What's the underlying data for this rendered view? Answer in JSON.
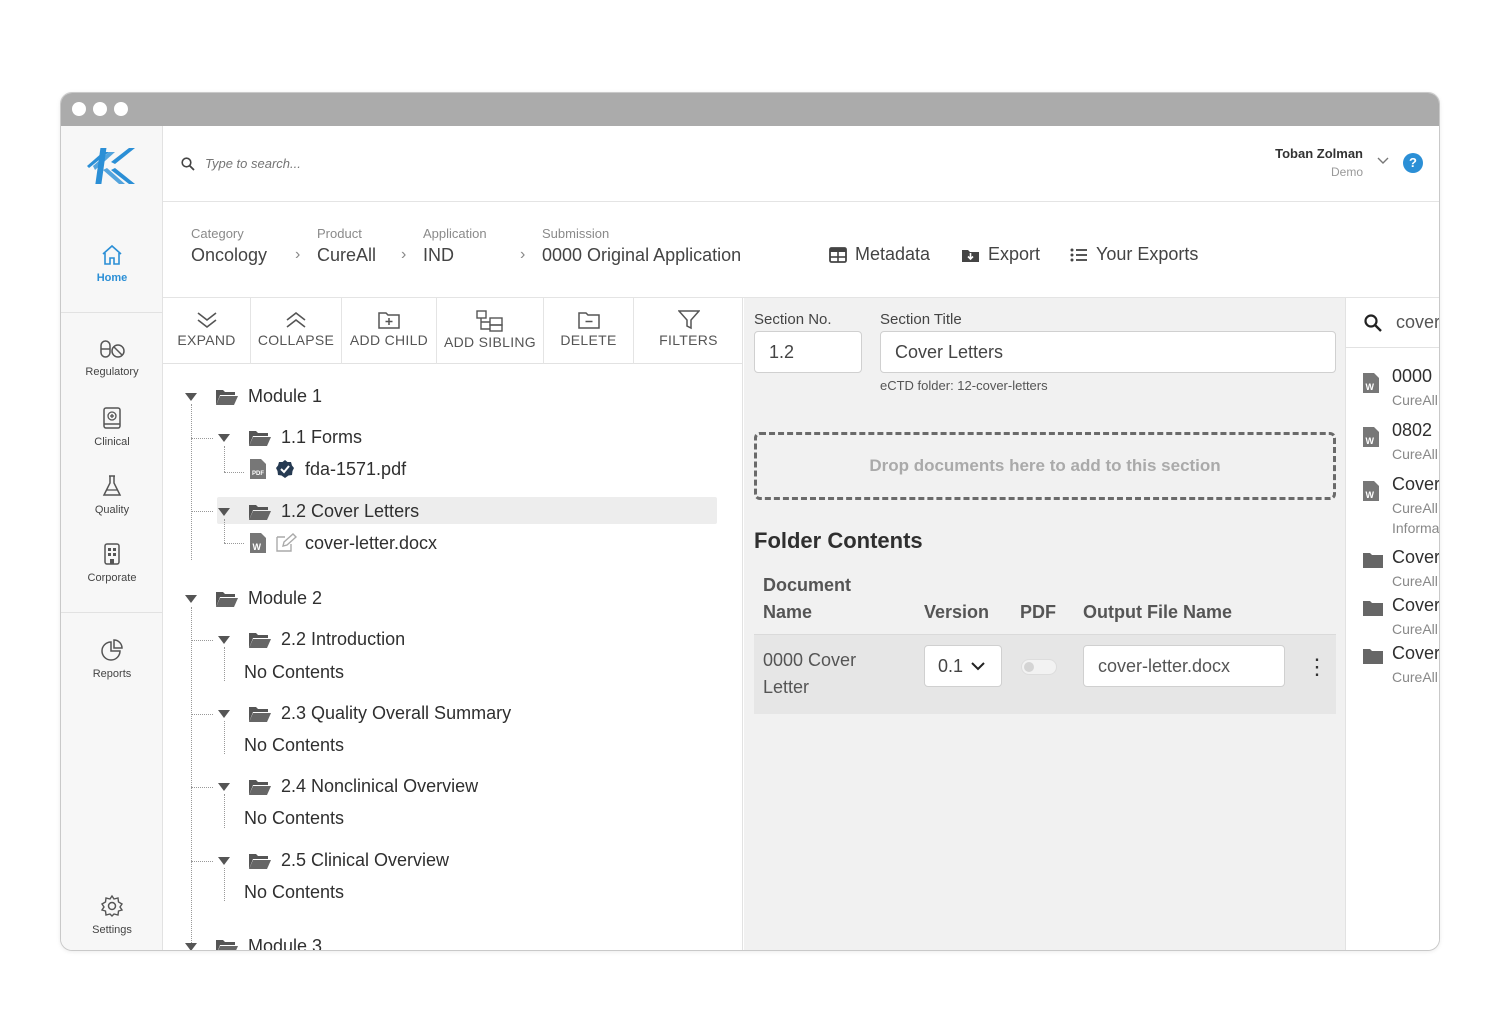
{
  "user": {
    "name": "Toban Zolman",
    "role": "Demo"
  },
  "search": {
    "placeholder": "Type to search..."
  },
  "nav": {
    "home": "Home",
    "regulatory": "Regulatory",
    "clinical": "Clinical",
    "quality": "Quality",
    "corporate": "Corporate",
    "reports": "Reports",
    "settings": "Settings"
  },
  "breadcrumb": [
    {
      "label": "Category",
      "value": "Oncology"
    },
    {
      "label": "Product",
      "value": "CureAll"
    },
    {
      "label": "Application",
      "value": "IND"
    },
    {
      "label": "Submission",
      "value": "0000 Original Application"
    }
  ],
  "actions": {
    "metadata": "Metadata",
    "export": "Export",
    "your_exports": "Your Exports"
  },
  "toolbar": {
    "expand": "EXPAND",
    "collapse": "COLLAPSE",
    "add_child": "ADD CHILD",
    "add_sibling": "ADD SIBLING",
    "delete": "DELETE",
    "filters": "FILTERS"
  },
  "tree": {
    "module1": "Module 1",
    "forms": "1.1 Forms",
    "fda_file": "fda-1571.pdf",
    "cover_letters": "1.2 Cover Letters",
    "cover_file": "cover-letter.docx",
    "module2": "Module 2",
    "intro": "2.2 Introduction",
    "qos": "2.3 Quality Overall Summary",
    "nonclinical": "2.4 Nonclinical Overview",
    "clinical": "2.5 Clinical Overview",
    "no_contents": "No Contents",
    "module3": "Module 3"
  },
  "section": {
    "no_label": "Section No.",
    "no_value": "1.2",
    "title_label": "Section Title",
    "title_value": "Cover Letters",
    "ectd_folder": "eCTD folder: 12-cover-letters",
    "dropzone": "Drop documents here to add to this section",
    "folder_contents": "Folder Contents"
  },
  "table": {
    "headers": {
      "doc_name_1": "Document",
      "doc_name_2": "Name",
      "version": "Version",
      "pdf": "PDF",
      "output": "Output File Name"
    },
    "rows": [
      {
        "name_1": "0000 Cover",
        "name_2": "Letter",
        "version": "0.1",
        "pdf": false,
        "output": "cover-letter.docx"
      }
    ]
  },
  "results": {
    "query": "cover",
    "items": [
      {
        "title": "0000",
        "sub": "CureAll",
        "icon": "word-file-icon"
      },
      {
        "title": "0802",
        "sub": "CureAll",
        "icon": "word-file-icon"
      },
      {
        "title": "Cover",
        "sub": "CureAll",
        "sub2": "Informa",
        "icon": "word-file-icon"
      },
      {
        "title": "Cover",
        "sub": "CureAll",
        "icon": "folder-icon"
      },
      {
        "title": "Cover",
        "sub": "CureAll",
        "icon": "folder-icon"
      },
      {
        "title": "Cover",
        "sub": "CureAll",
        "icon": "folder-icon"
      }
    ]
  },
  "colors": {
    "accent": "#2b8fd6",
    "titlebar": "#ababab",
    "panel": "#f1f1f1",
    "highlight": "#ededed"
  }
}
